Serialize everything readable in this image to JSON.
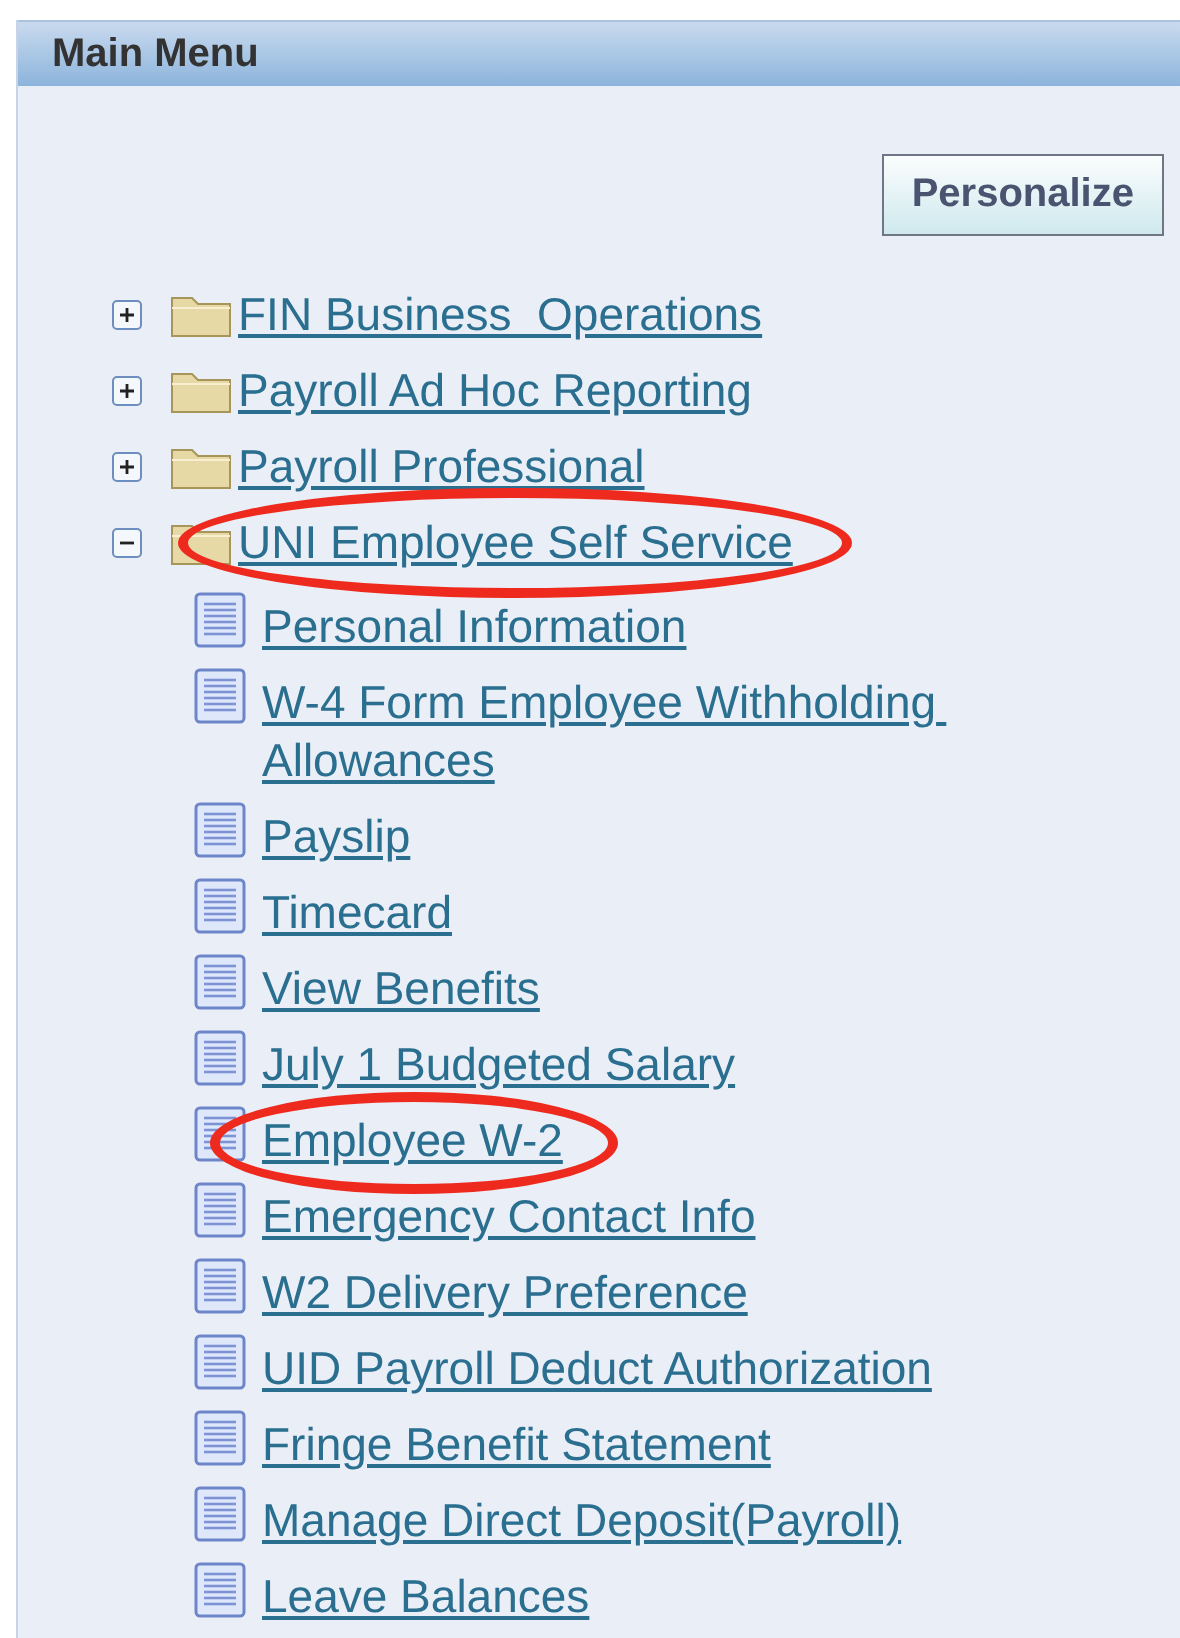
{
  "panel": {
    "title": "Main Menu"
  },
  "personalize_button": "Personalize",
  "folders": [
    {
      "label": "FIN Business  Operations",
      "expanded": false,
      "circled": false
    },
    {
      "label": "Payroll Ad Hoc Reporting",
      "expanded": false,
      "circled": false
    },
    {
      "label": "Payroll Professional",
      "expanded": false,
      "circled": false
    },
    {
      "label": "UNI Employee Self Service",
      "expanded": true,
      "circled": true,
      "children": [
        {
          "label": "Personal Information",
          "circled": false
        },
        {
          "label": "W-4 Form Employee Withholding Allowances",
          "circled": false
        },
        {
          "label": "Payslip",
          "circled": false
        },
        {
          "label": "Timecard",
          "circled": false
        },
        {
          "label": "View Benefits",
          "circled": false
        },
        {
          "label": "July 1 Budgeted Salary",
          "circled": false
        },
        {
          "label": "Employee W-2",
          "circled": true
        },
        {
          "label": "Emergency Contact Info",
          "circled": false
        },
        {
          "label": "W2 Delivery Preference",
          "circled": false
        },
        {
          "label": "UID Payroll Deduct Authorization",
          "circled": false
        },
        {
          "label": "Fringe Benefit Statement",
          "circled": false
        },
        {
          "label": "Manage Direct Deposit(Payroll)",
          "circled": false
        },
        {
          "label": "Leave Balances",
          "circled": false
        }
      ]
    }
  ]
}
